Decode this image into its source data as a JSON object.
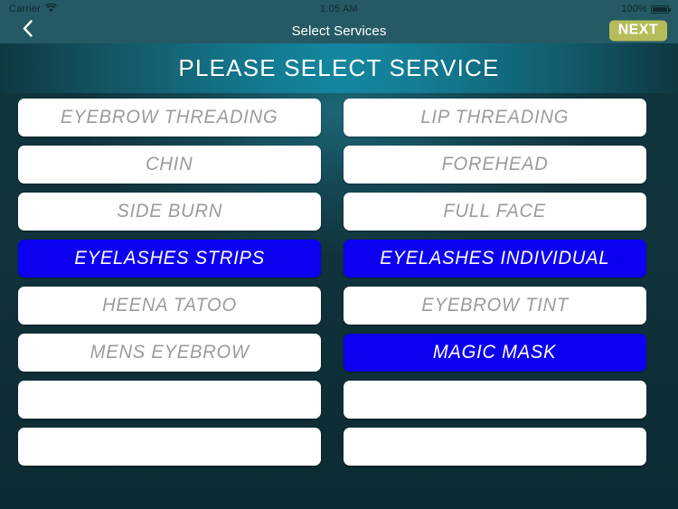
{
  "status_bar": {
    "carrier": "Carrier",
    "wifi_icon": "wifi-icon",
    "time": "1:05 AM",
    "battery_percent": "100%",
    "battery_icon": "battery-full-icon"
  },
  "nav_bar": {
    "back_icon": "chevron-left-icon",
    "title": "Select Services",
    "next_label": "NEXT",
    "next_bg_color": "#b5bd5a",
    "bar_color": "#255a64"
  },
  "banner": {
    "title": "PLEASE SELECT SERVICE"
  },
  "theme": {
    "selected_color": "#0d00f0",
    "unselected_color": "#ffffff",
    "unselected_text_color": "#9b9b9b",
    "selected_text_color": "#ffffff",
    "background_color": "#0f323a"
  },
  "services": [
    {
      "label": "EYEBROW THREADING",
      "selected": false
    },
    {
      "label": "LIP THREADING",
      "selected": false
    },
    {
      "label": "CHIN",
      "selected": false
    },
    {
      "label": "FOREHEAD",
      "selected": false
    },
    {
      "label": "SIDE BURN",
      "selected": false
    },
    {
      "label": "FULL FACE",
      "selected": false
    },
    {
      "label": "EYELASHES STRIPS",
      "selected": true
    },
    {
      "label": "EYELASHES INDIVIDUAL",
      "selected": true
    },
    {
      "label": "HEENA TATOO",
      "selected": false
    },
    {
      "label": "EYEBROW TINT",
      "selected": false
    },
    {
      "label": "MENS EYEBROW",
      "selected": false
    },
    {
      "label": "MAGIC MASK",
      "selected": true
    },
    {
      "label": "",
      "selected": false
    },
    {
      "label": "",
      "selected": false
    },
    {
      "label": "",
      "selected": false
    },
    {
      "label": "",
      "selected": false
    }
  ]
}
